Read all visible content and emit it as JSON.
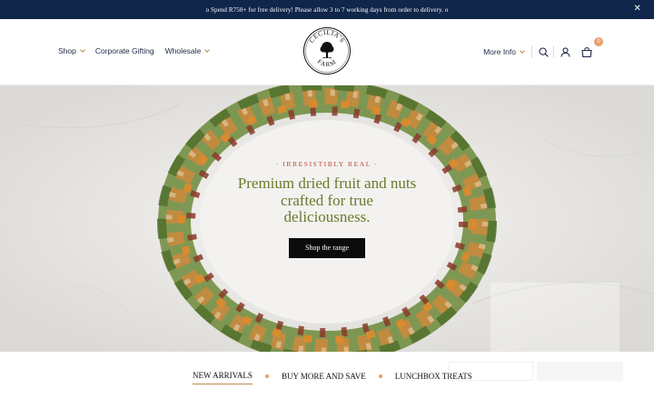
{
  "announcement": {
    "text": "o Spend R750+ for free delivery! Please allow 3 to 7 working days from order to delivery. o",
    "close_glyph": "✕"
  },
  "nav": {
    "left": [
      {
        "label": "Shop",
        "has_dropdown": true
      },
      {
        "label": "Corporate Gifting",
        "has_dropdown": false
      },
      {
        "label": "Wholesale",
        "has_dropdown": true
      }
    ],
    "more_info": "More Info",
    "cart_count": "0",
    "icons": [
      "search-icon",
      "account-icon",
      "cart-icon"
    ]
  },
  "logo": {
    "top_text": "CECILIA'S",
    "bottom_text": "FARM"
  },
  "hero": {
    "eyebrow": "· IRRESISTIBLY REAL ·",
    "title": "Premium dried fruit and nuts crafted for true deliciousness.",
    "cta": "Shop the range"
  },
  "tabs": [
    {
      "label": "NEW ARRIVALS",
      "active": true
    },
    {
      "label": "BUY MORE AND SAVE",
      "active": false
    },
    {
      "label": "LUNCHBOX TREATS",
      "active": false
    }
  ],
  "colors": {
    "announcement_bg": "#10264a",
    "hero_title": "#6b7a2c",
    "eyebrow": "#c0473a",
    "accent": "#e9a06a",
    "cta_bg": "#0b0b0b"
  }
}
